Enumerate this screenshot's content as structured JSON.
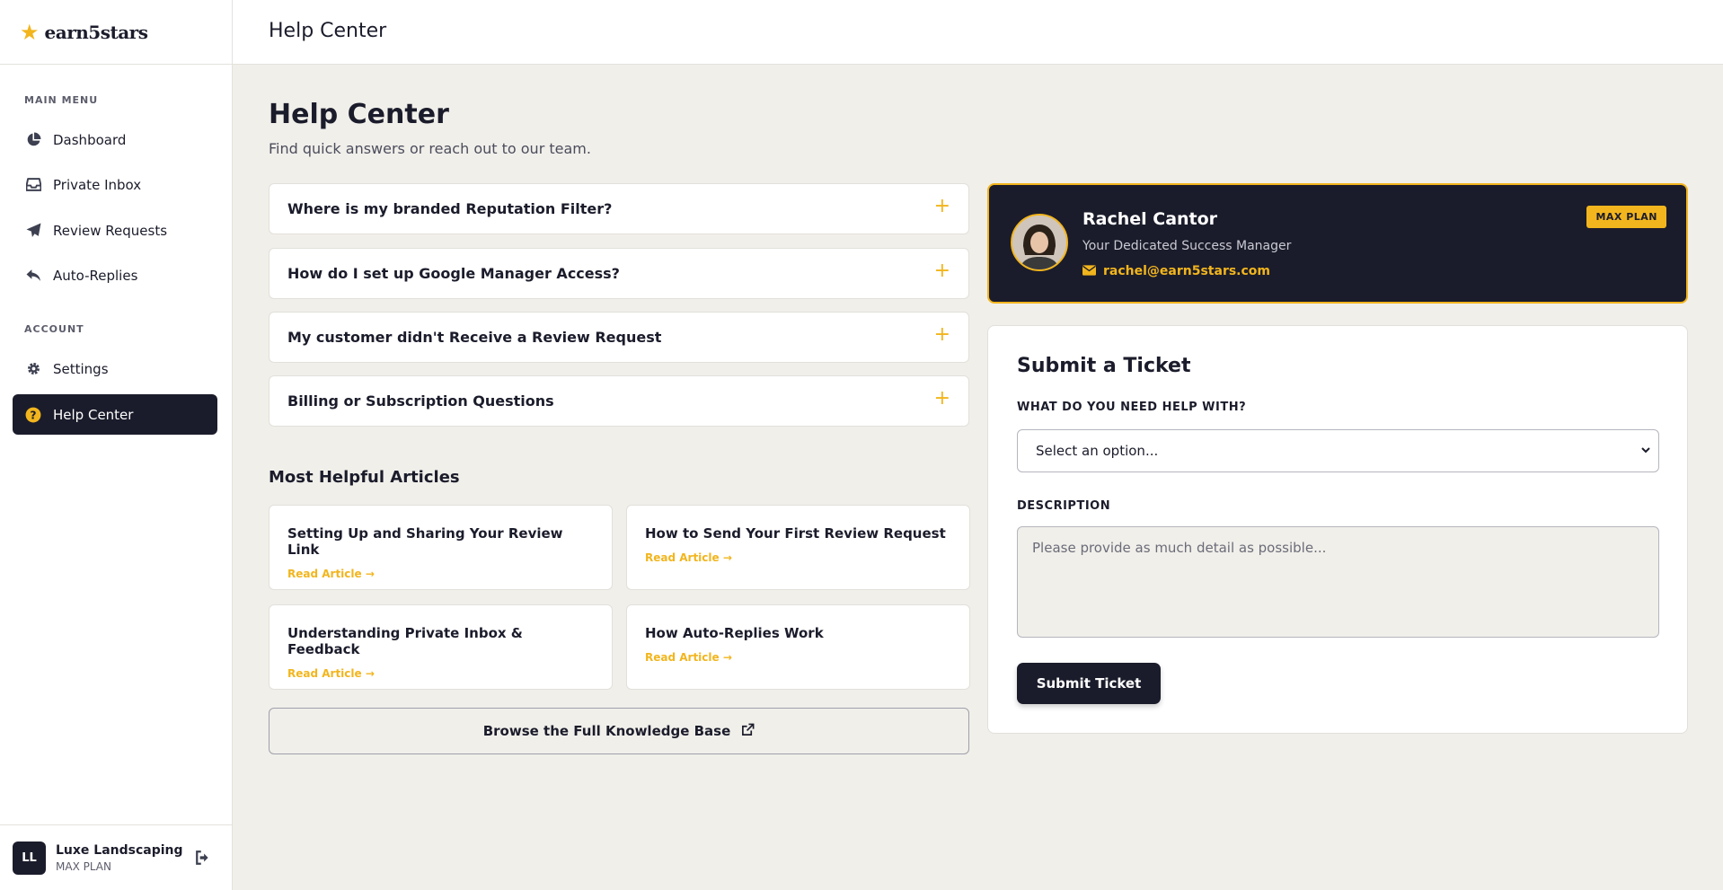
{
  "brand": {
    "name": "earn5stars"
  },
  "sidebar": {
    "main_menu_label": "MAIN MENU",
    "account_label": "ACCOUNT",
    "items": [
      {
        "label": "Dashboard",
        "icon": "pie-chart-icon"
      },
      {
        "label": "Private Inbox",
        "icon": "inbox-icon"
      },
      {
        "label": "Review Requests",
        "icon": "paper-plane-icon"
      },
      {
        "label": "Auto-Replies",
        "icon": "reply-icon"
      },
      {
        "label": "Settings",
        "icon": "gear-icon"
      },
      {
        "label": "Help Center",
        "icon": "question-circle-icon",
        "active": true
      }
    ],
    "user": {
      "initials": "LL",
      "name": "Luxe Landscaping",
      "plan": "MAX PLAN"
    }
  },
  "topbar": {
    "title": "Help Center"
  },
  "main": {
    "title": "Help Center",
    "subtitle": "Find quick answers or reach out to our team.",
    "faqs": [
      "Where is my branded Reputation Filter?",
      "How do I set up Google Manager Access?",
      "My customer didn't Receive a Review Request",
      "Billing or Subscription Questions"
    ],
    "articles_heading": "Most Helpful Articles",
    "articles": [
      {
        "title": "Setting Up and Sharing Your Review Link",
        "link": "Read Article →"
      },
      {
        "title": "How to Send Your First Review Request",
        "link": "Read Article →"
      },
      {
        "title": "Understanding Private Inbox & Feedback",
        "link": "Read Article →"
      },
      {
        "title": "How Auto-Replies Work",
        "link": "Read Article →"
      }
    ],
    "kb_button": "Browse the Full Knowledge Base"
  },
  "manager": {
    "name": "Rachel Cantor",
    "role": "Your Dedicated Success Manager",
    "email": "rachel@earn5stars.com",
    "badge": "MAX PLAN"
  },
  "ticket": {
    "title": "Submit a Ticket",
    "topic_label": "WHAT DO YOU NEED HELP WITH?",
    "topic_value": "Select an option...",
    "description_label": "DESCRIPTION",
    "description_placeholder": "Please provide as much detail as possible...",
    "submit_label": "Submit Ticket"
  },
  "colors": {
    "accent": "#f2b51d",
    "dark": "#1b1c2b",
    "background": "#f1efea"
  }
}
